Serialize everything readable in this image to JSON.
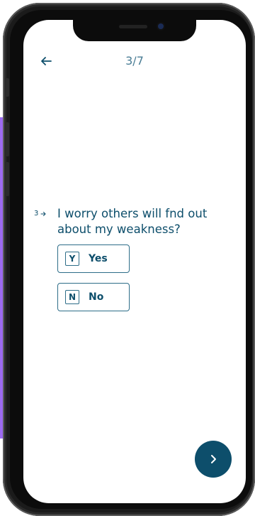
{
  "header": {
    "back_icon": "arrow-left-icon",
    "progress": "3/7"
  },
  "question": {
    "number": "3",
    "arrow_icon": "arrow-right-icon",
    "text": "I worry others will fnd out about my weakness?"
  },
  "options": [
    {
      "key": "Y",
      "label": "Yes"
    },
    {
      "key": "N",
      "label": "No"
    }
  ],
  "footer": {
    "next_icon": "chevron-right-icon"
  },
  "colors": {
    "accent": "#0d4e6b",
    "border": "#2d6d88",
    "muted": "#4a7d95",
    "side_panel": "#9d6bf0"
  }
}
